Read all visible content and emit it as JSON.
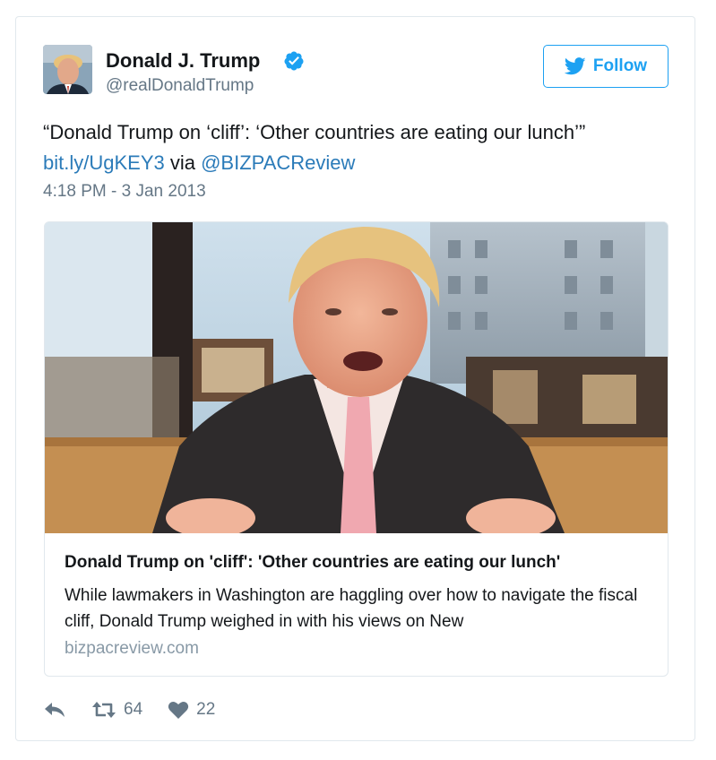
{
  "header": {
    "name": "Donald J. Trump",
    "handle": "@realDonaldTrump",
    "follow_label": "Follow",
    "verified_icon": "verified-badge-icon",
    "accent": "#1da1f2"
  },
  "tweet": {
    "text_main": "“Donald Trump on ‘cliff’: ‘Other countries are eating our lunch’”",
    "link": "bit.ly/UgKEY3",
    "via": " via ",
    "mention": "@BIZPACReview",
    "timestamp": "4:18 PM - 3 Jan 2013"
  },
  "card": {
    "title": "Donald Trump on 'cliff': 'Other countries are eating our lunch'",
    "description": "While lawmakers in Washington are haggling over how to navigate the fiscal cliff, Donald Trump weighed in with his views on New",
    "domain": "bizpacreview.com"
  },
  "actions": {
    "reply_icon": "reply-icon",
    "retweet_icon": "retweet-icon",
    "retweet_count": "64",
    "like_icon": "heart-icon",
    "like_count": "22"
  }
}
